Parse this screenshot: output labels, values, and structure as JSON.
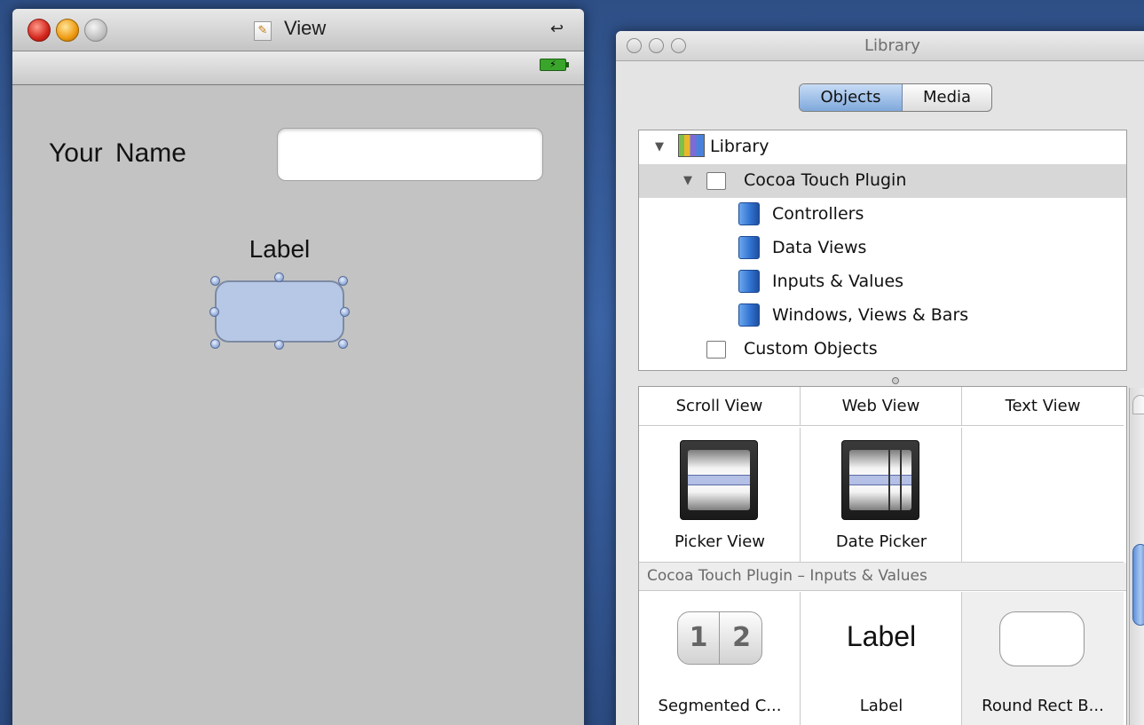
{
  "view_window": {
    "title": "View",
    "doc_icon": "xcode-document-icon",
    "collapse_glyph": "↩",
    "battery_glyph": "⚡",
    "canvas": {
      "name_label": "Your Name",
      "name_input_value": "",
      "output_label": "Label"
    }
  },
  "library_window": {
    "title": "Library",
    "tabs": {
      "objects": "Objects",
      "media": "Media",
      "selected": "Objects"
    },
    "tree": {
      "root": "Library",
      "plugin": "Cocoa Touch Plugin",
      "groups": [
        "Controllers",
        "Data Views",
        "Inputs & Values",
        "Windows, Views & Bars"
      ],
      "custom": "Custom Objects"
    },
    "grid": {
      "top_row": [
        "Scroll View",
        "Web View",
        "Text View"
      ],
      "tiles_row1": [
        "Picker View",
        "Date Picker"
      ],
      "section_header": "Cocoa Touch Plugin – Inputs & Values",
      "tiles_row2": [
        "Segmented C...",
        "Label",
        "Round Rect B..."
      ],
      "segmented_icon_values": [
        "1",
        "2"
      ],
      "label_icon_text": "Label"
    }
  },
  "colors": {
    "desktop": "#3b64a6",
    "canvas_bg": "#c3c3c3",
    "selected_button_fill": "#b7c8e6",
    "accent_blue": "#7fa9dc"
  }
}
